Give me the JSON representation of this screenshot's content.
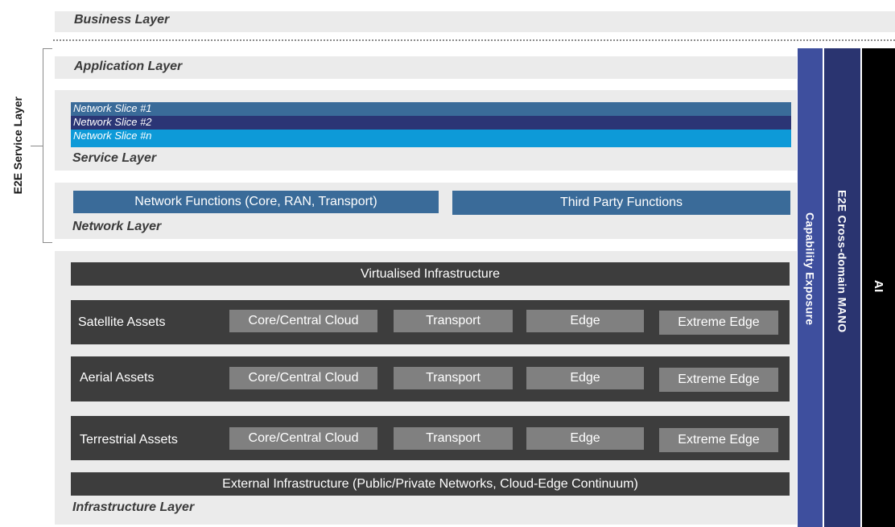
{
  "layers": {
    "business": "Business Layer",
    "application": "Application Layer",
    "service": "Service Layer",
    "network": "Network Layer",
    "infrastructure": "Infrastructure Layer"
  },
  "e2e_service_layer": "E2E Service Layer",
  "slices": [
    {
      "label": "Network Slice #1",
      "color": "#3a6b99"
    },
    {
      "label": "Network Slice #2",
      "color": "#2b3575"
    },
    {
      "label": "Network Slice #n",
      "color": "#0d9ad8"
    }
  ],
  "network_functions": {
    "core": "Network Functions (Core, RAN, Transport)",
    "third_party": "Third Party Functions"
  },
  "infrastructure": {
    "virtualised": "Virtualised Infrastructure",
    "external": "External Infrastructure (Public/Private Networks, Cloud-Edge Continuum)",
    "asset_rows": [
      {
        "label": "Satellite Assets",
        "cells": [
          "Core/Central Cloud",
          "Transport",
          "Edge",
          "Extreme Edge"
        ]
      },
      {
        "label": "Aerial Assets",
        "cells": [
          "Core/Central Cloud",
          "Transport",
          "Edge",
          "Extreme Edge"
        ]
      },
      {
        "label": "Terrestrial Assets",
        "cells": [
          "Core/Central Cloud",
          "Transport",
          "Edge",
          "Extreme Edge"
        ]
      }
    ]
  },
  "side_columns": {
    "capability_exposure": "Capability Exposure",
    "manO": "E2E Cross-domain MANO",
    "ai": "AI"
  },
  "colors": {
    "band": "#ebebeb",
    "capability": "#3e4f9e",
    "mano": "#2a3470",
    "ai": "#000000",
    "dark": "#3d3d3d",
    "cell": "#808080"
  }
}
